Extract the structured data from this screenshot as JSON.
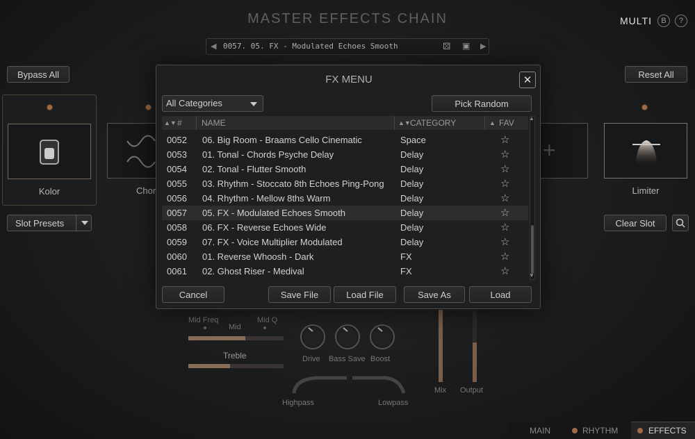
{
  "header": {
    "title": "MASTER EFFECTS CHAIN",
    "mode_label": "MULTI",
    "icon_b": "B",
    "icon_help": "?"
  },
  "preset_bar": {
    "name": "0057. 05. FX - Modulated Echoes Smooth",
    "prev_icon": "caret-left-icon",
    "next_icon": "caret-right-icon"
  },
  "toolbar": {
    "bypass_all": "Bypass All",
    "reset_all": "Reset All",
    "slot_presets": "Slot Presets",
    "clear_slot": "Clear Slot"
  },
  "slots": {
    "kolor": "Kolor",
    "chorus": "Chor",
    "limiter": "Limiter"
  },
  "background_controls": {
    "mid_freq": "Mid Freq",
    "mid": "Mid",
    "mid_q": "Mid Q",
    "treble": "Treble",
    "drive": "Drive",
    "bass_save": "Bass Save",
    "boost": "Boost",
    "mix": "Mix",
    "output": "Output",
    "highpass": "Highpass",
    "lowpass": "Lowpass"
  },
  "tabs": {
    "main": "MAIN",
    "rhythm": "RHYTHM",
    "effects": "EFFECTS"
  },
  "fx_menu": {
    "title": "FX MENU",
    "close": "✕",
    "category_selected": "All Categories",
    "pick_random": "Pick Random",
    "columns": {
      "num": "#",
      "name": "NAME",
      "category": "CATEGORY",
      "fav": "FAV"
    },
    "rows": [
      {
        "num": "0052",
        "name": "06. Big Room - Braams Cello Cinematic",
        "category": "Space",
        "fav": "☆"
      },
      {
        "num": "0053",
        "name": "01. Tonal - Chords Psyche Delay",
        "category": "Delay",
        "fav": "☆"
      },
      {
        "num": "0054",
        "name": "02. Tonal - Flutter Smooth",
        "category": "Delay",
        "fav": "☆"
      },
      {
        "num": "0055",
        "name": "03. Rhythm - Stoccato 8th Echoes Ping-Pong",
        "category": "Delay",
        "fav": "☆"
      },
      {
        "num": "0056",
        "name": "04. Rhythm - Mellow 8ths Warm",
        "category": "Delay",
        "fav": "☆"
      },
      {
        "num": "0057",
        "name": "05. FX - Modulated Echoes Smooth",
        "category": "Delay",
        "fav": "☆"
      },
      {
        "num": "0058",
        "name": "06. FX - Reverse Echoes Wide",
        "category": "Delay",
        "fav": "☆"
      },
      {
        "num": "0059",
        "name": "07. FX - Voice Multiplier Modulated",
        "category": "Delay",
        "fav": "☆"
      },
      {
        "num": "0060",
        "name": "01. Reverse Whoosh - Dark",
        "category": "FX",
        "fav": "☆"
      },
      {
        "num": "0061",
        "name": "02. Ghost Riser - Medival",
        "category": "FX",
        "fav": "☆"
      }
    ],
    "selected_num": "0057",
    "buttons": {
      "cancel": "Cancel",
      "save_file": "Save File",
      "load_file": "Load File",
      "save_as": "Save As",
      "load": "Load"
    }
  }
}
